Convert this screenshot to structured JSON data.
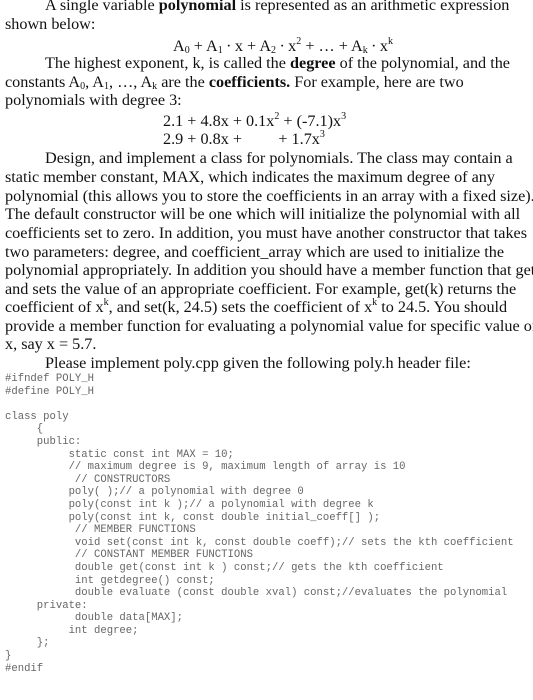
{
  "paragraphs": {
    "p1_line1_pre": "A single variable ",
    "p1_line1_bold": "polynomial",
    "p1_line1_post": " is represented as an arithmetic expression",
    "p1_line2": "shown below:",
    "formula": {
      "a0": "A",
      "s0": "0",
      "t0": " + ",
      "a1": "A",
      "s1": "1",
      "t1": " ∙ x + ",
      "a2": "A",
      "s2": "2",
      "t2": " ∙ x",
      "e2": "2",
      "t3": " + … + ",
      "ak": "A",
      "sk": "k",
      "tk": " ∙ x",
      "ek": "k"
    },
    "p2_line1_pre": "The highest exponent, k, is called the ",
    "p2_line1_bold": "degree",
    "p2_line1_post": " of the polynomial, and the",
    "p2_line2_a": "constants A",
    "p2_line2_s0": "0",
    "p2_line2_b": ", A",
    "p2_line2_s1": "1",
    "p2_line2_c": ", …, A",
    "p2_line2_sk": "k",
    "p2_line2_d": " are the ",
    "p2_line2_bold": "coefficients.",
    "p2_line2_e": " For example, here are two",
    "p2_line3": "polynomials with degree 3:",
    "poly1": {
      "a": "2.1 + 4.8x + 0.1x",
      "e1": "2",
      "b": " + (-7.1)x",
      "e2": "3"
    },
    "poly2": {
      "a": "2.9 + 0.8x +         + 1.7x",
      "e1": "3"
    },
    "p3_lines": [
      "Design, and implement a class for polynomials. The class may contain a",
      "static member constant, MAX, which indicates the maximum degree of any",
      "polynomial (this allows you to store the coefficients in an array with a fixed size).",
      "The default constructor will be one which will initialize the polynomial with all",
      "coefficients set to zero. In addition, you must have another constructor that takes",
      "two parameters: degree, and coefficient_array which are used to initialize the",
      "polynomial appropriately. In addition you should have a member function that gets",
      "and sets the value of an appropriate coefficient. For example, get(k) returns the"
    ],
    "p3_line9_a": "coefficient of x",
    "p3_line9_e1": "k",
    "p3_line9_b": ", and set(k, 24.5) sets the coefficient of x",
    "p3_line9_e2": "k",
    "p3_line9_c": " to 24.5. You should",
    "p3_line10": "provide a member function for evaluating a polynomial value for specific value of",
    "p3_line11": "x, say x = 5.7.",
    "p4": "Please implement poly.cpp given the following poly.h header file:"
  },
  "code_lines": [
    "#ifndef POLY_H",
    "#define POLY_H",
    "",
    "class poly",
    "     {",
    "     public:",
    "          static const int MAX = 10;",
    "          // maximum degree is 9, maximum length of array is 10",
    "           // CONSTRUCTORS",
    "          poly( );// a polynomial with degree 0",
    "          poly(const int k );// a polynomial with degree k",
    "          poly(const int k, const double initial_coeff[] );",
    "           // MEMBER FUNCTIONS",
    "           void set(const int k, const double coeff);// sets the kth coefficient",
    "           // CONSTANT MEMBER FUNCTIONS",
    "           double get(const int k ) const;// gets the kth coefficient",
    "           int getdegree() const;",
    "           double evaluate (const double xval) const;//evaluates the polynomial",
    "     private:",
    "           double data[MAX];",
    "          int degree;",
    "     };",
    "}",
    "#endif"
  ]
}
